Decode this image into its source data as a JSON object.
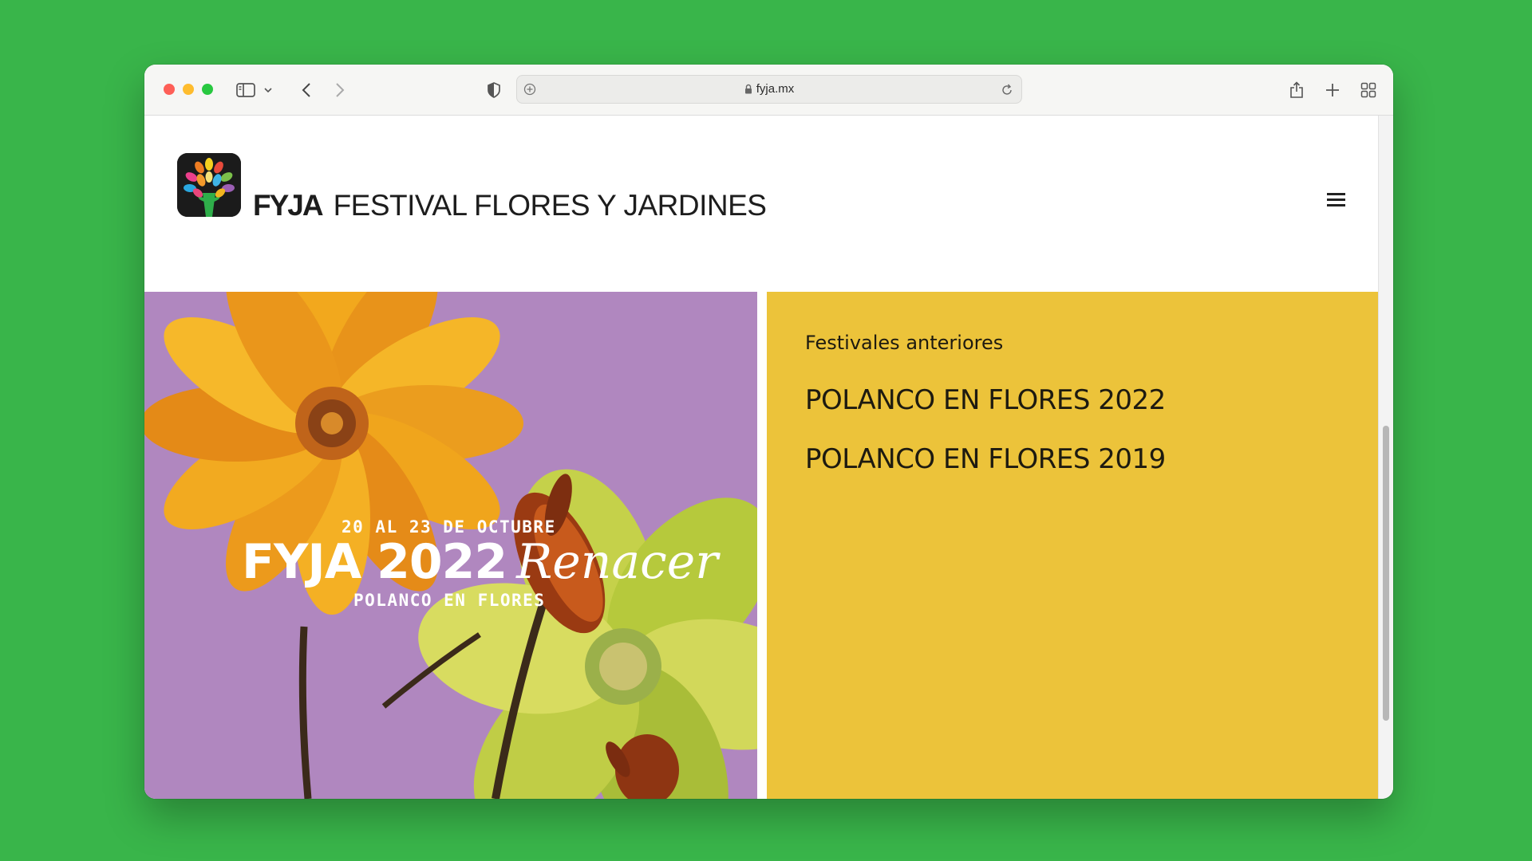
{
  "browser": {
    "url": "fyja.mx"
  },
  "site": {
    "logo_abbr": "FYJA",
    "logo_name": "FESTIVAL FLORES Y JARDINES"
  },
  "hero": {
    "dates": "20 AL 23 DE OCTUBRE",
    "title": "FYJA 2022",
    "title_script": "Renacer",
    "subtitle": "POLANCO EN FLORES"
  },
  "past_festivals": {
    "heading": "Festivales anteriores",
    "items": [
      {
        "label": "POLANCO EN FLORES 2022"
      },
      {
        "label": "POLANCO EN FLORES 2019"
      }
    ]
  },
  "colors": {
    "background": "#39b54a",
    "panel": "#ecc33a",
    "hero_bg": "#b087bf"
  }
}
